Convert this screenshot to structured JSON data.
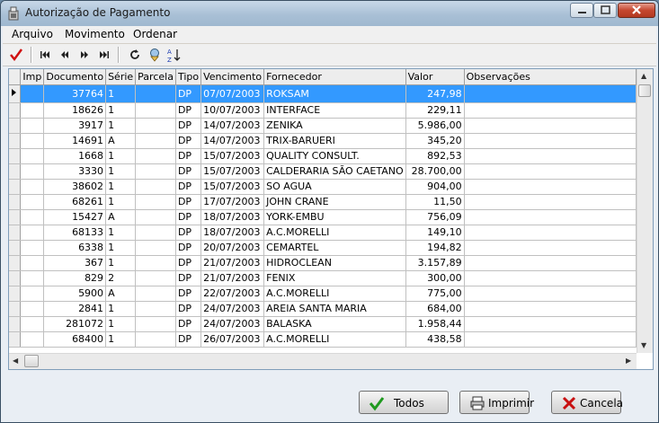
{
  "window": {
    "title": "Autorização de Pagamento"
  },
  "menu": [
    "Arquivo",
    "Movimento",
    "Ordenar"
  ],
  "toolbar": {
    "icons": [
      "check-icon",
      "first-icon",
      "prior-icon",
      "next-icon",
      "last-icon",
      "refresh-icon",
      "filter-icon",
      "sort-az-icon"
    ]
  },
  "grid": {
    "columns": [
      "Imp",
      "Documento",
      "Série",
      "Parcela",
      "Tipo",
      "Vencimento",
      "Fornecedor",
      "Valor",
      "Observações"
    ],
    "rows": [
      [
        "",
        "37764",
        "1",
        "",
        "DP",
        "07/07/2003",
        "ROKSAM",
        "247,98",
        ""
      ],
      [
        "",
        "18626",
        "1",
        "",
        "DP",
        "10/07/2003",
        "INTERFACE",
        "229,11",
        ""
      ],
      [
        "",
        "3917",
        "1",
        "",
        "DP",
        "14/07/2003",
        "ZENIKA",
        "5.986,00",
        ""
      ],
      [
        "",
        "14691",
        "A",
        "",
        "DP",
        "14/07/2003",
        "TRIX-BARUERI",
        "345,20",
        ""
      ],
      [
        "",
        "1668",
        "1",
        "",
        "DP",
        "15/07/2003",
        "QUALITY CONSULT.",
        "892,53",
        ""
      ],
      [
        "",
        "3330",
        "1",
        "",
        "DP",
        "15/07/2003",
        "CALDERARIA SÃO CAETANO",
        "28.700,00",
        ""
      ],
      [
        "",
        "38602",
        "1",
        "",
        "DP",
        "15/07/2003",
        "SO AGUA",
        "904,00",
        ""
      ],
      [
        "",
        "68261",
        "1",
        "",
        "DP",
        "17/07/2003",
        "JOHN CRANE",
        "11,50",
        ""
      ],
      [
        "",
        "15427",
        "A",
        "",
        "DP",
        "18/07/2003",
        "YORK-EMBU",
        "756,09",
        ""
      ],
      [
        "",
        "68133",
        "1",
        "",
        "DP",
        "18/07/2003",
        "A.C.MORELLI",
        "149,10",
        ""
      ],
      [
        "",
        "6338",
        "1",
        "",
        "DP",
        "20/07/2003",
        "CEMARTEL",
        "194,82",
        ""
      ],
      [
        "",
        "367",
        "1",
        "",
        "DP",
        "21/07/2003",
        "HIDROCLEAN",
        "3.157,89",
        ""
      ],
      [
        "",
        "829",
        "2",
        "",
        "DP",
        "21/07/2003",
        "FENIX",
        "300,00",
        ""
      ],
      [
        "",
        "5900",
        "A",
        "",
        "DP",
        "22/07/2003",
        "A.C.MORELLI",
        "775,00",
        ""
      ],
      [
        "",
        "2841",
        "1",
        "",
        "DP",
        "24/07/2003",
        "AREIA SANTA MARIA",
        "684,00",
        ""
      ],
      [
        "",
        "281072",
        "1",
        "",
        "DP",
        "24/07/2003",
        "BALASKA",
        "1.958,44",
        ""
      ],
      [
        "",
        "68400",
        "1",
        "",
        "DP",
        "26/07/2003",
        "A.C.MORELLI",
        "438,58",
        ""
      ]
    ],
    "selected_row": 0
  },
  "buttons": {
    "todos": "Todos",
    "imprimir": "Imprimir",
    "cancela": "Cancela"
  }
}
